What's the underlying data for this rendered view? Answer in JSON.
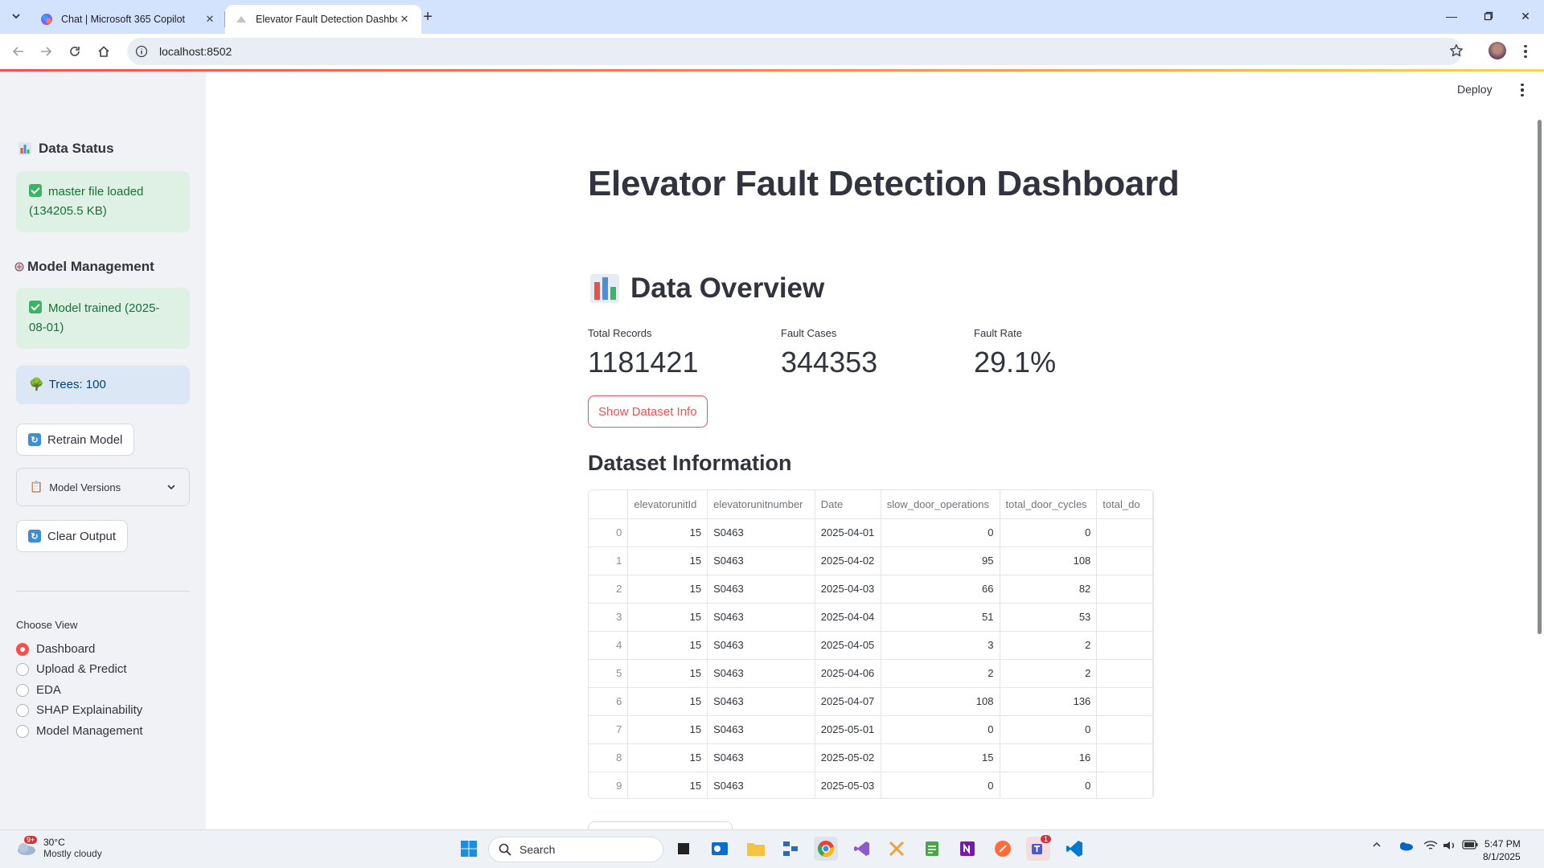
{
  "browser": {
    "tabs": [
      {
        "title": "Chat | Microsoft 365 Copilot",
        "active": false
      },
      {
        "title": "Elevator Fault Detection Dashbo",
        "active": true
      }
    ],
    "url": "localhost:8502"
  },
  "app": {
    "deploy_label": "Deploy",
    "sidebar": {
      "data_status_heading": "Data Status",
      "data_status_alert": "master file loaded (134205.5 KB)",
      "model_mgmt_heading": "Model Management",
      "model_trained_alert": "Model trained (2025-08-01)",
      "trees_info": "Trees: 100",
      "retrain_button": "Retrain Model",
      "model_versions_expander": "Model Versions",
      "clear_output_button": "Clear Output",
      "choose_view_label": "Choose View",
      "views": [
        {
          "label": "Dashboard",
          "selected": true
        },
        {
          "label": "Upload & Predict",
          "selected": false
        },
        {
          "label": "EDA",
          "selected": false
        },
        {
          "label": "SHAP Explainability",
          "selected": false
        },
        {
          "label": "Model Management",
          "selected": false
        }
      ]
    },
    "main": {
      "title": "Elevator Fault Detection Dashboard",
      "overview_heading": "Data Overview",
      "metrics": [
        {
          "label": "Total Records",
          "value": "1181421"
        },
        {
          "label": "Fault Cases",
          "value": "344353"
        },
        {
          "label": "Fault Rate",
          "value": "29.1%"
        }
      ],
      "dataset_info_button": "Show Dataset Info",
      "dataset_info_heading": "Dataset Information",
      "table": {
        "columns": [
          "",
          "elevatorunitId",
          "elevatorunitnumber",
          "Date",
          "slow_door_operations",
          "total_door_cycles",
          "total_do"
        ],
        "rows": [
          [
            "0",
            "15",
            "S0463",
            "2025-04-01",
            "0",
            "0",
            ""
          ],
          [
            "1",
            "15",
            "S0463",
            "2025-04-02",
            "95",
            "108",
            ""
          ],
          [
            "2",
            "15",
            "S0463",
            "2025-04-03",
            "66",
            "82",
            ""
          ],
          [
            "3",
            "15",
            "S0463",
            "2025-04-04",
            "51",
            "53",
            ""
          ],
          [
            "4",
            "15",
            "S0463",
            "2025-04-05",
            "3",
            "2",
            ""
          ],
          [
            "5",
            "15",
            "S0463",
            "2025-04-06",
            "2",
            "2",
            ""
          ],
          [
            "6",
            "15",
            "S0463",
            "2025-04-07",
            "108",
            "136",
            ""
          ],
          [
            "7",
            "15",
            "S0463",
            "2025-05-01",
            "0",
            "0",
            ""
          ],
          [
            "8",
            "15",
            "S0463",
            "2025-05-02",
            "15",
            "16",
            ""
          ],
          [
            "9",
            "15",
            "S0463",
            "2025-05-03",
            "0",
            "0",
            ""
          ]
        ]
      }
    }
  },
  "taskbar": {
    "weather_badge": "9+",
    "weather_temp": "30°C",
    "weather_desc": "Mostly cloudy",
    "search_placeholder": "Search",
    "time": "5:47 PM",
    "date": "8/1/2025",
    "teams_badge": "1"
  },
  "colors": {
    "accent": "#ff4b4b",
    "sidebar_bg": "#f0f2f6",
    "success_bg": "#dff0e5",
    "info_bg": "#dce7f5",
    "tabbar_bg": "#d3e3fd"
  }
}
